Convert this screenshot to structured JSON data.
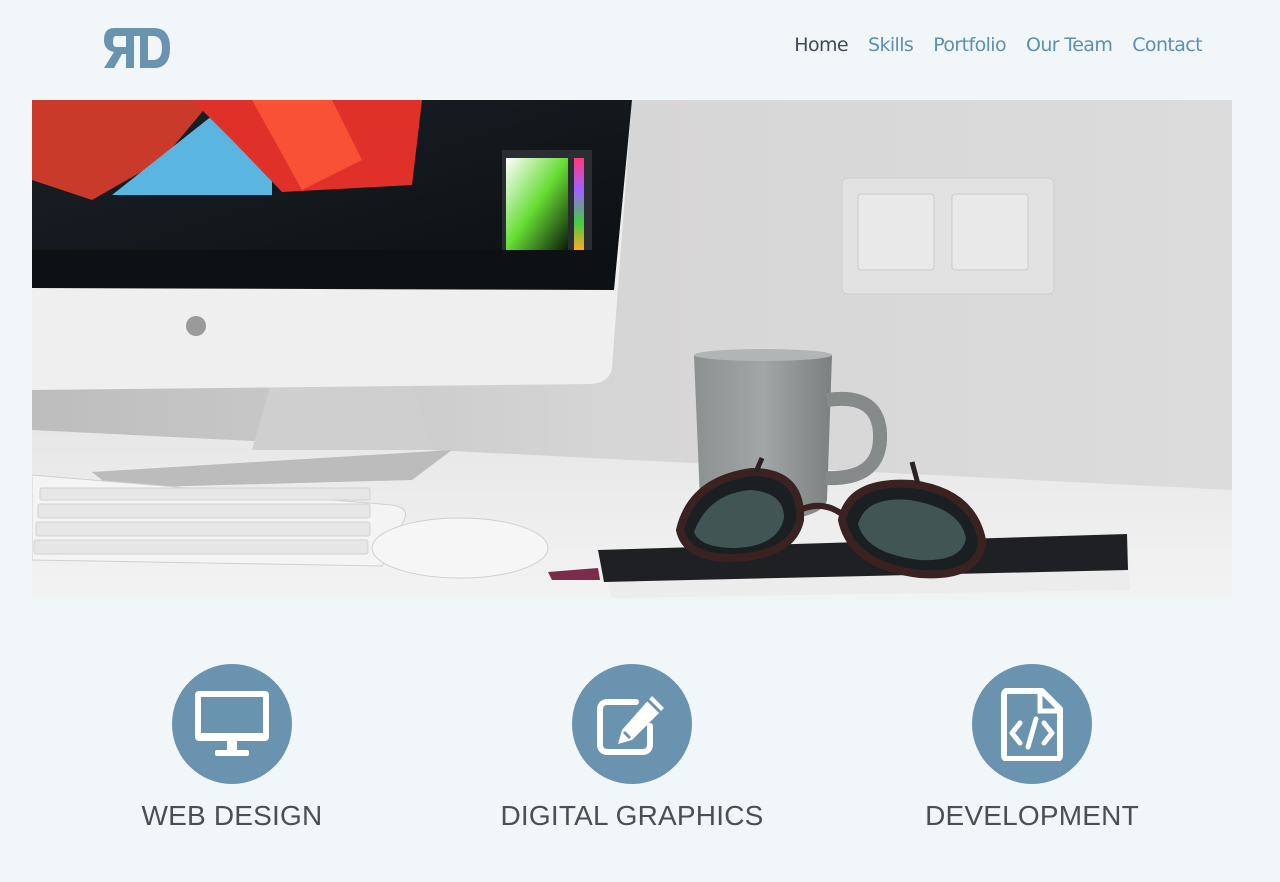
{
  "brand": {
    "logo_icon": "rd-monogram-logo",
    "accent_color": "#6a93b0"
  },
  "nav": {
    "items": [
      {
        "label": "Home",
        "active": true
      },
      {
        "label": "Skills",
        "active": false
      },
      {
        "label": "Portfolio",
        "active": false
      },
      {
        "label": "Our Team",
        "active": false
      },
      {
        "label": "Contact",
        "active": false
      }
    ]
  },
  "hero": {
    "image": "desk-with-imac-keyboard-mouse-mug-glasses-notebook"
  },
  "features": [
    {
      "label": "WEB DESIGN",
      "icon": "monitor-icon"
    },
    {
      "label": "DIGITAL GRAPHICS",
      "icon": "edit-pencil-icon"
    },
    {
      "label": "DEVELOPMENT",
      "icon": "code-file-icon"
    }
  ]
}
